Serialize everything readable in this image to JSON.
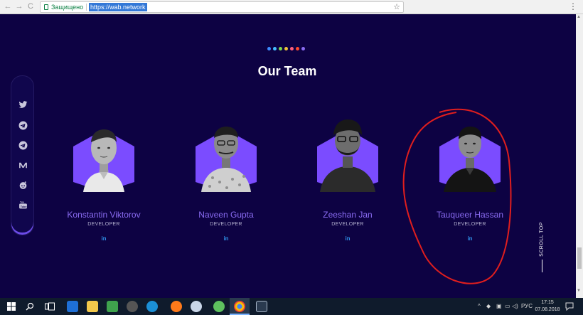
{
  "browser": {
    "back": "←",
    "forward": "→",
    "reload": "C",
    "secure_label": "Защищено",
    "url": "https://wab.network",
    "star": "☆",
    "menu": "⋮"
  },
  "page": {
    "title": "Our Team",
    "dot_colors": [
      "#3d8bff",
      "#45c0ff",
      "#7cd94a",
      "#f2c43a",
      "#ff5e7a",
      "#ff4b2b",
      "#8a6cf2"
    ],
    "accent": "#8a6cf2"
  },
  "social": [
    {
      "icon": "twitter-icon",
      "glyph": "🐦"
    },
    {
      "icon": "telegram-icon",
      "glyph": "➤"
    },
    {
      "icon": "telegram-icon-2",
      "glyph": "➤"
    },
    {
      "icon": "medium-icon",
      "glyph": "M"
    },
    {
      "icon": "reddit-icon",
      "glyph": "◉"
    },
    {
      "icon": "youtube-icon",
      "glyph": "▶"
    }
  ],
  "team": [
    {
      "name": "Konstantin Viktorov",
      "role": "DEVELOPER",
      "linkedin": "in"
    },
    {
      "name": "Naveen Gupta",
      "role": "DEVELOPER",
      "linkedin": "in"
    },
    {
      "name": "Zeeshan Jan",
      "role": "DEVELOPER",
      "linkedin": "in"
    },
    {
      "name": "Tauqueer Hassan",
      "role": "DEVELOPER",
      "linkedin": "in"
    }
  ],
  "scroll_top": "SCROLL TOP",
  "taskbar": {
    "lang": "РУС",
    "time": "17:15",
    "date": "07.08.2018"
  }
}
